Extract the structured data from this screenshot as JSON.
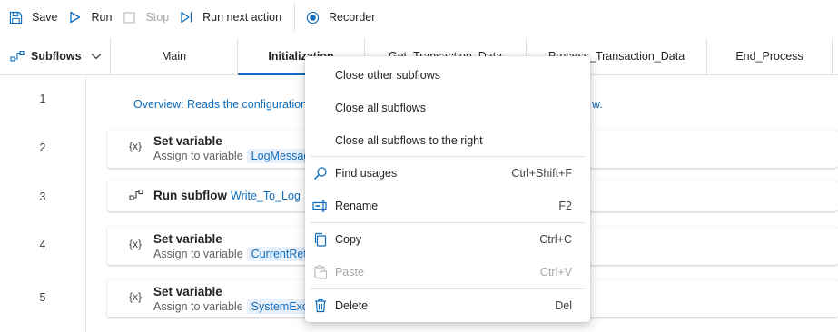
{
  "toolbar": {
    "save": "Save",
    "run": "Run",
    "stop": "Stop",
    "run_next": "Run next action",
    "recorder": "Recorder"
  },
  "tabs": {
    "subflows": "Subflows",
    "items": [
      "Main",
      "Initialization",
      "Get_Transaction_Data",
      "Process_Transaction_Data",
      "End_Process"
    ]
  },
  "canvas": {
    "line_numbers": [
      "1",
      "2",
      "3",
      "4",
      "5"
    ],
    "comment": "Overview: Reads the configuration fi",
    "comment_tail": "w.",
    "actions": [
      {
        "title": "Set variable",
        "sub_prefix": "Assign to variable",
        "var": "LogMessage"
      },
      {
        "title": "Run subflow",
        "link": "Write_To_Log"
      },
      {
        "title": "Set variable",
        "sub_prefix": "Assign to variable",
        "var": "CurrentRetry"
      },
      {
        "title": "Set variable",
        "sub_prefix": "Assign to variable",
        "var": "SystemExce"
      }
    ],
    "set_variable_icon": "{x}"
  },
  "context_menu": {
    "items": [
      {
        "label": "Close other subflows",
        "shortcut": ""
      },
      {
        "label": "Close all subflows",
        "shortcut": ""
      },
      {
        "label": "Close all subflows to the right",
        "shortcut": ""
      },
      {
        "label": "Find usages",
        "shortcut": "Ctrl+Shift+F",
        "icon": "search-icon"
      },
      {
        "label": "Rename",
        "shortcut": "F2",
        "icon": "rename-icon"
      },
      {
        "label": "Copy",
        "shortcut": "Ctrl+C",
        "icon": "copy-icon"
      },
      {
        "label": "Paste",
        "shortcut": "Ctrl+V",
        "icon": "paste-icon",
        "disabled": true
      },
      {
        "label": "Delete",
        "shortcut": "Del",
        "icon": "trash-icon"
      }
    ]
  },
  "colors": {
    "accent": "#0f6cbd",
    "disabled": "#a6a6a6"
  }
}
